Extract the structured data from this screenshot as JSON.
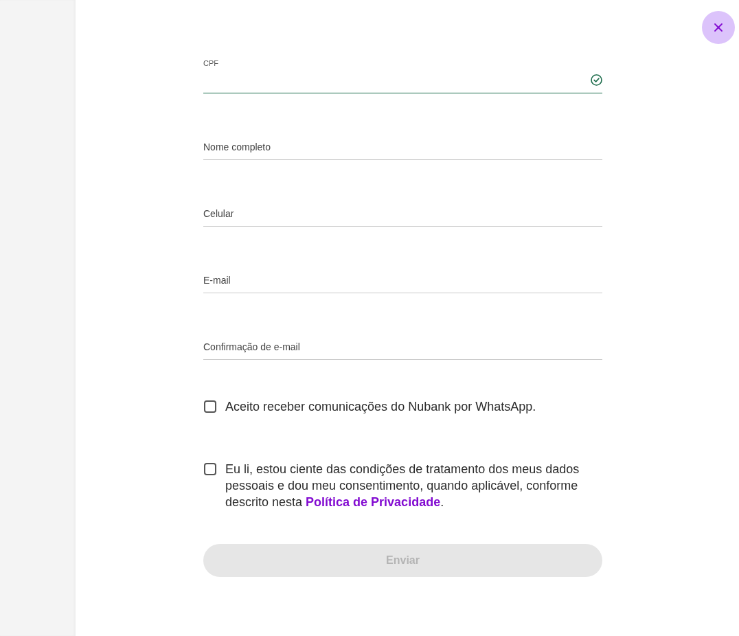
{
  "fields": [
    {
      "label": "CPF",
      "floating": true,
      "valid": true
    },
    {
      "label": "Nome completo",
      "floating": false,
      "valid": false
    },
    {
      "label": "Celular",
      "floating": false,
      "valid": false
    },
    {
      "label": "E-mail",
      "floating": false,
      "valid": false
    },
    {
      "label": "Confirmação de e-mail",
      "floating": false,
      "valid": false
    }
  ],
  "consents": [
    {
      "text": "Aceito receber comunicações do Nubank por WhatsApp.",
      "checked": false
    },
    {
      "text": "Eu li, estou ciente das condições de tratamento dos meus dados pessoais e dou meu consentimento, quando aplicável, conforme descrito nesta ",
      "link": "Política de Privacidade",
      "after": ".",
      "checked": false
    }
  ],
  "submit": {
    "label": "Enviar",
    "disabled": true
  }
}
